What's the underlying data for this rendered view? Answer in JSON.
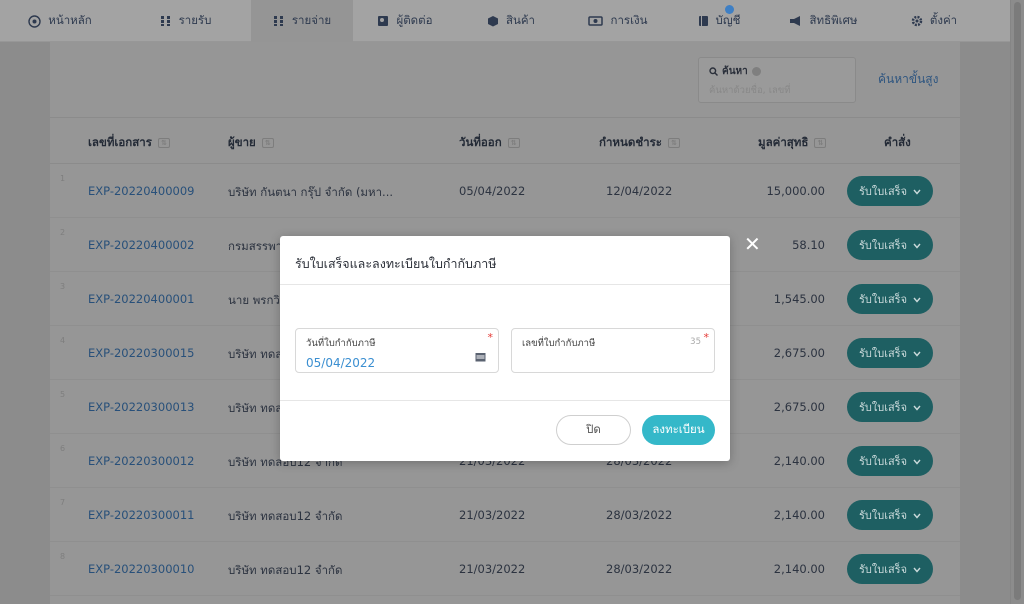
{
  "nav": [
    {
      "label": "หน้าหลัก",
      "icon": "home-icon"
    },
    {
      "label": "รายรับ",
      "icon": "income-icon"
    },
    {
      "label": "รายจ่าย",
      "icon": "expense-icon",
      "active": true
    },
    {
      "label": "ผู้ติดต่อ",
      "icon": "contact-icon"
    },
    {
      "label": "สินค้า",
      "icon": "product-box-icon"
    },
    {
      "label": "การเงิน",
      "icon": "money-icon"
    },
    {
      "label": "บัญชี",
      "icon": "book-icon"
    },
    {
      "label": "สิทธิพิเศษ",
      "icon": "megaphone-icon"
    },
    {
      "label": "ตั้งค่า",
      "icon": "gear-icon"
    }
  ],
  "search": {
    "label": "ค้นหา",
    "placeholder": "ค้นหาด้วยชื่อ, เลขที่",
    "advanced": "ค้นหาขั้นสูง"
  },
  "table": {
    "headers": [
      "เลขที่เอกสาร",
      "ผู้ขาย",
      "วันที่ออก",
      "กำหนดชำระ",
      "มูลค่าสุทธิ",
      "คำสั่ง"
    ],
    "rows": [
      {
        "no": "1",
        "doc": "EXP-20220400009",
        "vendor": "บริษัท กันตนา กรุ๊ป จำกัด (มหา...",
        "issue": "05/04/2022",
        "due": "12/04/2022",
        "amount": "15,000.00",
        "action": "รับใบเสร็จ"
      },
      {
        "no": "2",
        "doc": "EXP-20220400002",
        "vendor": "กรมสรรพา",
        "issue": "",
        "due": "",
        "amount": "58.10",
        "action": "รับใบเสร็จ"
      },
      {
        "no": "3",
        "doc": "EXP-20220400001",
        "vendor": "นาย พรกวิ",
        "issue": "",
        "due": "",
        "amount": "1,545.00",
        "action": "รับใบเสร็จ"
      },
      {
        "no": "4",
        "doc": "EXP-20220300015",
        "vendor": "บริษัท ทดส",
        "issue": "",
        "due": "",
        "amount": "2,675.00",
        "action": "รับใบเสร็จ"
      },
      {
        "no": "5",
        "doc": "EXP-20220300013",
        "vendor": "บริษัท ทดส",
        "issue": "",
        "due": "",
        "amount": "2,675.00",
        "action": "รับใบเสร็จ"
      },
      {
        "no": "6",
        "doc": "EXP-20220300012",
        "vendor": "บริษัท ทดสอบ12 จำกัด",
        "issue": "21/03/2022",
        "due": "28/03/2022",
        "amount": "2,140.00",
        "action": "รับใบเสร็จ"
      },
      {
        "no": "7",
        "doc": "EXP-20220300011",
        "vendor": "บริษัท ทดสอบ12 จำกัด",
        "issue": "21/03/2022",
        "due": "28/03/2022",
        "amount": "2,140.00",
        "action": "รับใบเสร็จ"
      },
      {
        "no": "8",
        "doc": "EXP-20220300010",
        "vendor": "บริษัท ทดสอบ12 จำกัด",
        "issue": "21/03/2022",
        "due": "28/03/2022",
        "amount": "2,140.00",
        "action": "รับใบเสร็จ"
      }
    ]
  },
  "modal": {
    "title": "รับใบเสร็จและลงทะเบียนใบกำกับภาษี",
    "date_label": "วันที่ใบกำกับภาษี",
    "date_value": "05/04/2022",
    "invoice_label": "เลขที่ใบกำกับภาษี",
    "invoice_counter": "35",
    "required_mark": "*",
    "close_label": "ปิด",
    "register_label": "ลงทะเบียน",
    "dismiss_glyph": "✕"
  },
  "colors": {
    "accent": "#35b8c9",
    "row_button": "#1e5f62",
    "link": "#3b8fd1",
    "required": "#e53935"
  }
}
